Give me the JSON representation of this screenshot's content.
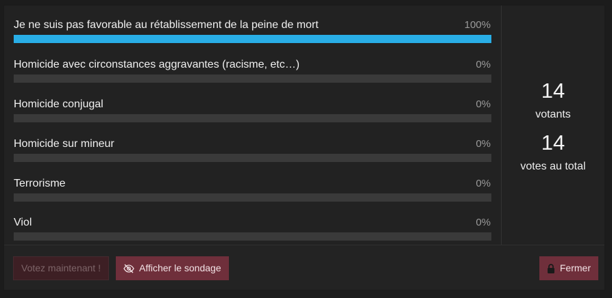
{
  "poll": {
    "options": [
      {
        "label": "Je ne suis pas favorable au rétablissement de la peine de mort",
        "percent_text": "100%",
        "percent": 100
      },
      {
        "label": "Homicide avec circonstances aggravantes (racisme, etc…)",
        "percent_text": "0%",
        "percent": 0
      },
      {
        "label": "Homicide conjugal",
        "percent_text": "0%",
        "percent": 0
      },
      {
        "label": "Homicide sur mineur",
        "percent_text": "0%",
        "percent": 0
      },
      {
        "label": "Terrorisme",
        "percent_text": "0%",
        "percent": 0
      },
      {
        "label": "Viol",
        "percent_text": "0%",
        "percent": 0
      }
    ],
    "bar_color": "#29aee6",
    "stats": {
      "voters_count": "14",
      "voters_label": "votants",
      "votes_count": "14",
      "votes_label": "votes au total"
    }
  },
  "footer": {
    "vote_label": "Votez maintenant !",
    "show_label": "Afficher le sondage",
    "show_icon": "eye-slash-icon",
    "close_label": "Fermer",
    "close_icon": "lock-icon",
    "accent_color": "#6f2f3b"
  }
}
